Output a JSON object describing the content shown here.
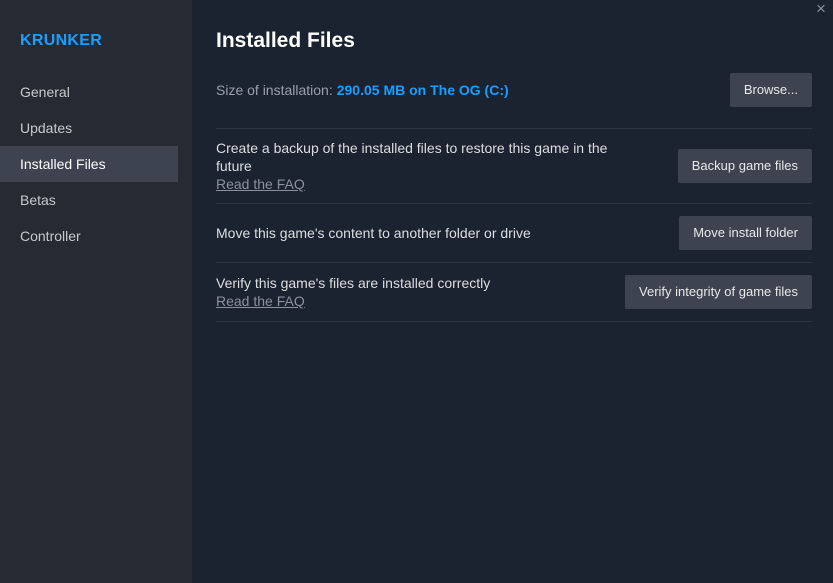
{
  "sidebar": {
    "game_title": "KRUNKER",
    "items": [
      {
        "label": "General"
      },
      {
        "label": "Updates"
      },
      {
        "label": "Installed Files"
      },
      {
        "label": "Betas"
      },
      {
        "label": "Controller"
      }
    ],
    "active_item": "Installed Files"
  },
  "window": {
    "close_icon": "×"
  },
  "main": {
    "title": "Installed Files",
    "size": {
      "label": "Size of installation:",
      "value": "290.05 MB on The OG (C:)",
      "browse_label": "Browse..."
    },
    "backup": {
      "description": "Create a backup of the installed files to restore this game in the future",
      "faq_link": "Read the FAQ",
      "button_label": "Backup game files"
    },
    "move": {
      "description": "Move this game's content to another folder or drive",
      "button_label": "Move install folder"
    },
    "verify": {
      "description": "Verify this game's files are installed correctly",
      "faq_link": "Read the FAQ",
      "button_label": "Verify integrity of game files"
    }
  },
  "colors": {
    "accent": "#1a9fff",
    "background": "#1b2230",
    "sidebar": "#262a33",
    "button": "#3d4450"
  }
}
